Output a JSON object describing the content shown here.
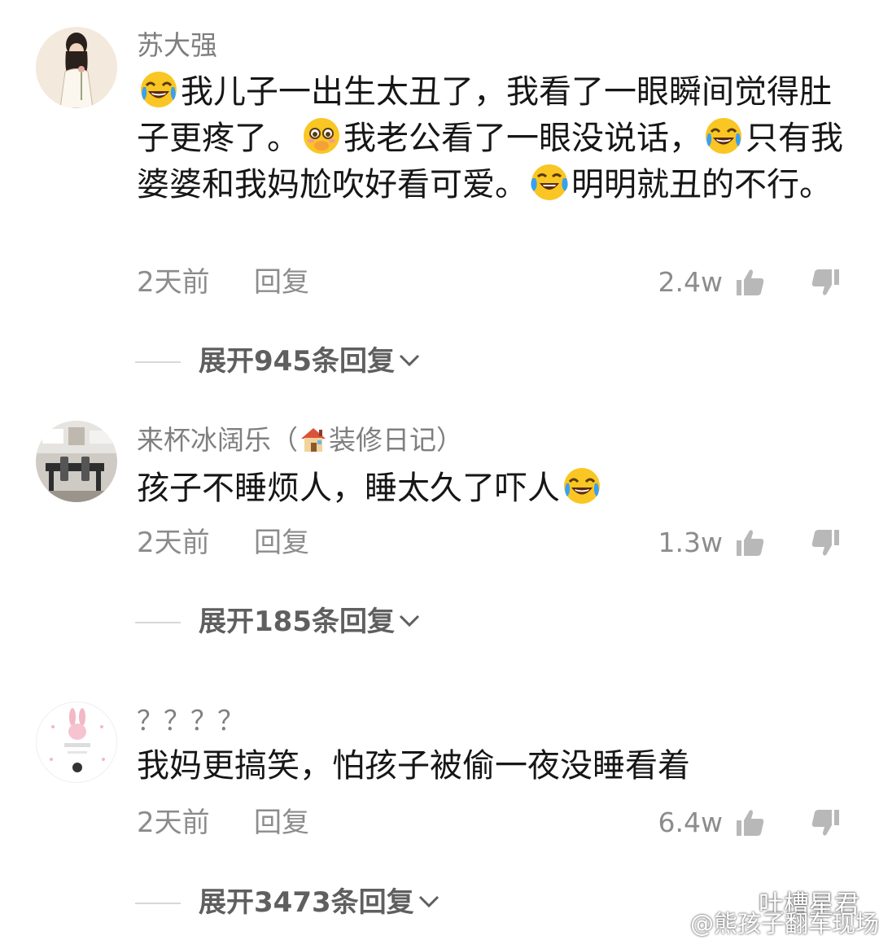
{
  "comments": [
    {
      "username": "苏大强",
      "text_parts": [
        "我儿子一出生太丑了，我看了一眼瞬间觉得肚子更疼了。",
        "我老公看了一眼没说话，",
        "只有我婆婆和我妈尬吹好看可爱。",
        "明明就丑的不行。"
      ],
      "time": "2天前",
      "reply_label": "回复",
      "likes": "2.4w",
      "expand_label": "展开945条回复"
    },
    {
      "username": "来杯冰阔乐（",
      "username_suffix": "装修日记）",
      "text_parts": [
        "孩子不睡烦人，睡太久了吓人"
      ],
      "time": "2天前",
      "reply_label": "回复",
      "likes": "1.3w",
      "expand_label": "展开185条回复"
    },
    {
      "username": "？？？？",
      "text_parts": [
        "我妈更搞笑，怕孩子被偷一夜没睡看着"
      ],
      "time": "2天前",
      "reply_label": "回复",
      "likes": "6.4w",
      "expand_label": "展开3473条回复"
    }
  ],
  "watermarks": {
    "wechat": "吐槽星君",
    "weibo": "@熊孩子翻车现场"
  },
  "icons": [
    "laugh-cry-emoji",
    "pleading-emoji",
    "tears-of-joy-emoji",
    "house-emoji",
    "thumbs-up-icon",
    "thumbs-down-icon",
    "chevron-down-icon",
    "wechat-icon",
    "weibo-icon"
  ],
  "colors": {
    "text": "#161616",
    "meta": "#8c8c8c",
    "username": "#7f7f7f",
    "emoji": "#f9c623"
  }
}
